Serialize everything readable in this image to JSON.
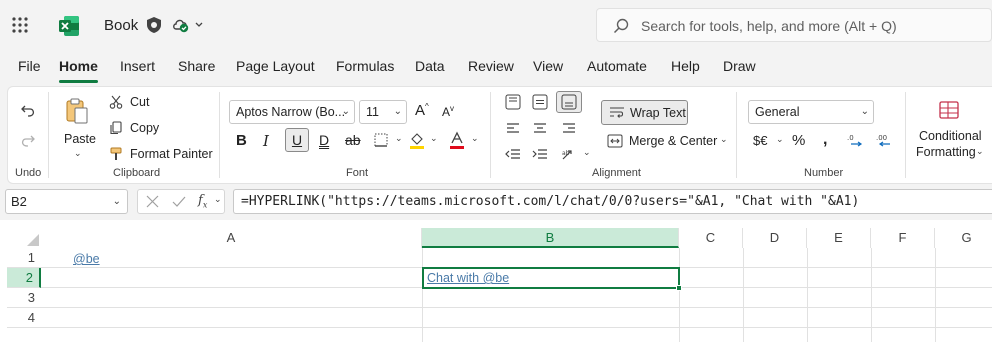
{
  "app": {
    "book_name": "Book",
    "search_placeholder": "Search for tools, help, and more (Alt + Q)"
  },
  "tabs": [
    "File",
    "Home",
    "Insert",
    "Share",
    "Page Layout",
    "Formulas",
    "Data",
    "Review",
    "View",
    "Automate",
    "Help",
    "Draw"
  ],
  "active_tab": "Home",
  "ribbon": {
    "undo_label": "Undo",
    "clipboard": {
      "paste": "Paste",
      "cut": "Cut",
      "copy": "Copy",
      "format_painter": "Format Painter",
      "group": "Clipboard"
    },
    "font": {
      "family": "Aptos Narrow (Bo...",
      "size": "11",
      "group": "Font"
    },
    "alignment": {
      "wrap_text": "Wrap Text",
      "merge_center": "Merge & Center",
      "group": "Alignment"
    },
    "number": {
      "format": "General",
      "group": "Number"
    },
    "styles": {
      "conditional": "Conditional",
      "formatting": "Formatting"
    }
  },
  "formula_bar": {
    "name_box": "B2",
    "formula": "=HYPERLINK(\"https://teams.microsoft.com/l/chat/0/0?users=\"&A1, \"Chat with \"&A1)"
  },
  "sheet": {
    "columns": [
      "A",
      "B",
      "C",
      "D",
      "E",
      "F",
      "G"
    ],
    "rows": [
      "1",
      "2",
      "3",
      "4"
    ],
    "selected_column": "B",
    "selected_row": "2",
    "a1": "@be",
    "b2": "Chat with @be"
  },
  "colors": {
    "accent": "#107c41",
    "link": "#4a7aa8",
    "selection_header": "#caead8"
  }
}
